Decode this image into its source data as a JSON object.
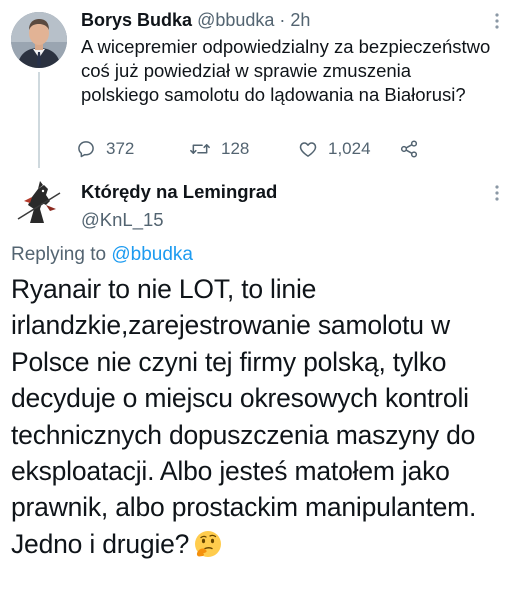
{
  "parent_tweet": {
    "display_name": "Borys Budka",
    "handle": "@bbudka",
    "separator": "·",
    "time": "2h",
    "text": "A wicepremier odpowiedzialny za bezpieczeństwo coś już powiedział w sprawie zmuszenia polskiego samolotu do lądowania na Białorusi?",
    "actions": {
      "reply_icon": "reply-bubble-icon",
      "reply_count": "372",
      "retweet_icon": "retweet-icon",
      "retweet_count": "128",
      "like_icon": "heart-icon",
      "like_count": "1,024",
      "share_icon": "share-icon"
    },
    "more_icon": "more-vertical-icon"
  },
  "reply_tweet": {
    "display_name": "Którędy na Lemingrad",
    "handle": "@KnL_15",
    "replying_prefix": "Replying to",
    "replying_mention": "@bbudka",
    "text": "Ryanair to nie LOT, to linie irlandzkie,zarejestrowanie samolotu w Polsce nie czyni tej firmy polską, tylko decyduje o miejscu okresowych kontroli technicznych dopuszczenia maszyny do eksploatacji. Albo jesteś matołem jako prawnik, albo prostackim manipulantem. Jedno i drugie?",
    "emoji": "thinking-face-emoji",
    "more_icon": "more-vertical-icon"
  },
  "colors": {
    "text": "#0f1419",
    "secondary": "#536471",
    "link": "#1d9bf0",
    "thread_line": "#cfd9de"
  }
}
